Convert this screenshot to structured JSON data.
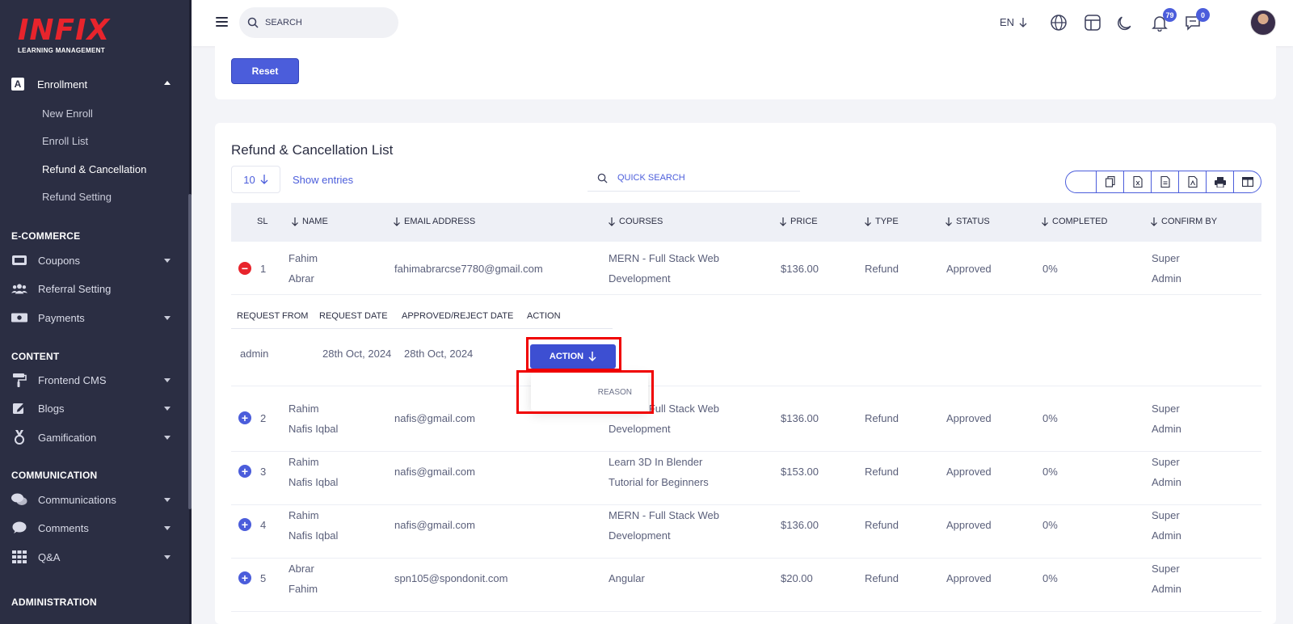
{
  "app": {
    "logo_text": "INFIX",
    "logo_subtitle": "LEARNING MANAGEMENT"
  },
  "sidebar": {
    "active_group": {
      "label": "Enrollment",
      "icon": "enrollment-icon"
    },
    "sub_items": [
      {
        "label": "New Enroll",
        "active": false
      },
      {
        "label": "Enroll List",
        "active": false
      },
      {
        "label": "Refund & Cancellation",
        "active": true
      },
      {
        "label": "Refund Setting",
        "active": false
      }
    ],
    "sections": [
      {
        "title": "E-COMMERCE",
        "items": [
          {
            "label": "Coupons",
            "icon": "coupon-icon",
            "has_caret": true
          },
          {
            "label": "Referral Setting",
            "icon": "users-icon",
            "has_caret": false
          },
          {
            "label": "Payments",
            "icon": "money-icon",
            "has_caret": true
          }
        ]
      },
      {
        "title": "CONTENT",
        "items": [
          {
            "label": "Frontend CMS",
            "icon": "paint-roller-icon",
            "has_caret": true
          },
          {
            "label": "Blogs",
            "icon": "edit-icon",
            "has_caret": true
          },
          {
            "label": "Gamification",
            "icon": "medal-icon",
            "has_caret": true
          }
        ]
      },
      {
        "title": "COMMUNICATION",
        "items": [
          {
            "label": "Communications",
            "icon": "chat-icon",
            "has_caret": true
          },
          {
            "label": "Comments",
            "icon": "comment-icon",
            "has_caret": true
          },
          {
            "label": "Q&A",
            "icon": "grid-icon",
            "has_caret": true
          }
        ]
      },
      {
        "title": "ADMINISTRATION",
        "items": []
      }
    ]
  },
  "header": {
    "search_placeholder": "SEARCH",
    "language": "EN",
    "notification_count": "79",
    "message_count": "0"
  },
  "top_card": {
    "reset_label": "Reset"
  },
  "list": {
    "title": "Refund & Cancellation List",
    "page_size": "10",
    "show_entries_label": "Show entries",
    "quick_search_placeholder": "QUICK SEARCH",
    "columns": [
      "SL",
      "NAME",
      "EMAIL ADDRESS",
      "COURSES",
      "PRICE",
      "TYPE",
      "STATUS",
      "COMPLETED",
      "CONFIRM BY"
    ],
    "rows": [
      {
        "sl": "1",
        "name_1": "Fahim",
        "name_2": "Abrar",
        "email": "fahimabrarcse7780@gmail.com",
        "course_1": "MERN - Full Stack Web",
        "course_2": "Development",
        "price": "$136.00",
        "type": "Refund",
        "status": "Approved",
        "completed": "0%",
        "confirm_1": "Super",
        "confirm_2": "Admin",
        "expanded": true
      },
      {
        "sl": "2",
        "name_1": "Rahim",
        "name_2": "Nafis Iqbal",
        "email": "nafis@gmail.com",
        "course_1": "MERN - Full Stack Web",
        "course_2": "Development",
        "price": "$136.00",
        "type": "Refund",
        "status": "Approved",
        "completed": "0%",
        "confirm_1": "Super",
        "confirm_2": "Admin",
        "expanded": false
      },
      {
        "sl": "3",
        "name_1": "Rahim",
        "name_2": "Nafis Iqbal",
        "email": "nafis@gmail.com",
        "course_1": "Learn 3D In Blender",
        "course_2": "Tutorial for Beginners",
        "price": "$153.00",
        "type": "Refund",
        "status": "Approved",
        "completed": "0%",
        "confirm_1": "Super",
        "confirm_2": "Admin",
        "expanded": false
      },
      {
        "sl": "4",
        "name_1": "Rahim",
        "name_2": "Nafis Iqbal",
        "email": "nafis@gmail.com",
        "course_1": "MERN - Full Stack Web",
        "course_2": "Development",
        "price": "$136.00",
        "type": "Refund",
        "status": "Approved",
        "completed": "0%",
        "confirm_1": "Super",
        "confirm_2": "Admin",
        "expanded": false
      },
      {
        "sl": "5",
        "name_1": "Abrar",
        "name_2": "Fahim",
        "email": "spn105@spondonit.com",
        "course_1": "Angular",
        "course_2": "",
        "price": "$20.00",
        "type": "Refund",
        "status": "Approved",
        "completed": "0%",
        "confirm_1": "Super",
        "confirm_2": "Admin",
        "expanded": false
      }
    ],
    "detail": {
      "columns": [
        "REQUEST FROM",
        "REQUEST DATE",
        "APPROVED/REJECT DATE",
        "ACTION"
      ],
      "request_from": "admin",
      "request_date": "28th Oct, 2024",
      "approved_date": "28th Oct, 2024",
      "action_label": "ACTION",
      "dropdown_item": "REASON"
    }
  },
  "colors": {
    "sidebar_bg": "#2b2e43",
    "accent": "#4b5ddb",
    "danger": "#e8242c",
    "highlight": "#f00000"
  }
}
